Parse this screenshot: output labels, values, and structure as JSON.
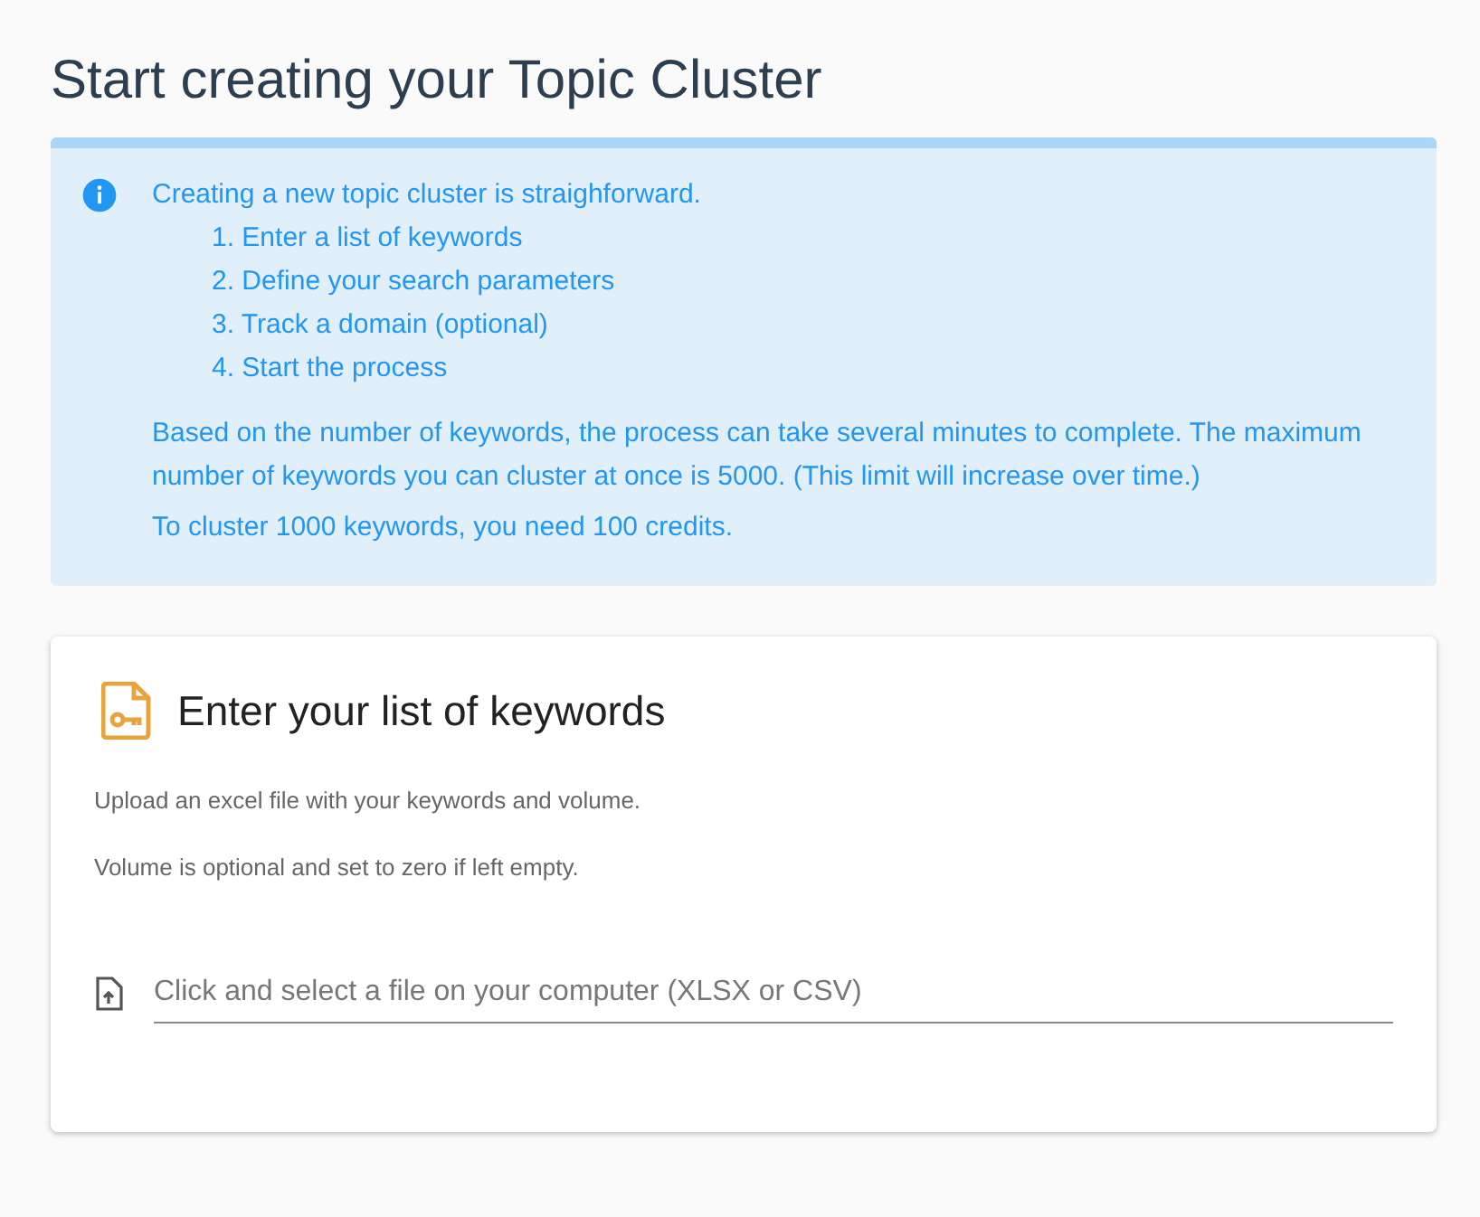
{
  "title": "Start creating your Topic Cluster",
  "alert": {
    "intro": "Creating a new topic cluster is straighforward.",
    "steps": [
      "1. Enter a list of keywords",
      "2. Define your search parameters",
      "3. Track a domain (optional)",
      "4. Start the process"
    ],
    "notes": [
      "Based on the number of keywords, the process can take several minutes to complete. The maximum number of keywords you can cluster at once is 5000. (This limit will increase over time.)",
      "To cluster 1000 keywords, you need 100 credits."
    ]
  },
  "card": {
    "heading": "Enter your list of keywords",
    "descriptions": [
      "Upload an excel file with your keywords and volume.",
      "Volume is optional and set to zero if left empty."
    ],
    "file_field": {
      "placeholder": "Click and select a file on your computer (XLSX or CSV)"
    }
  }
}
